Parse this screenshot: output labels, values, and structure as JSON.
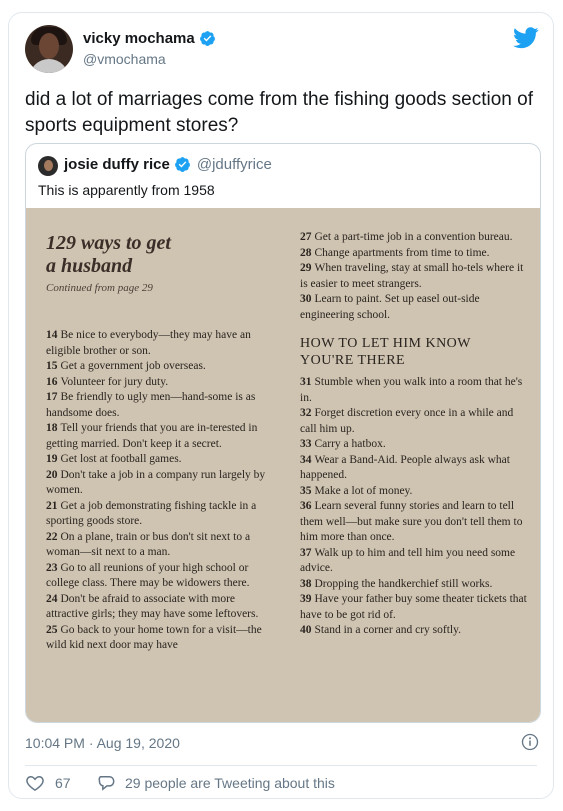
{
  "tweet": {
    "author_name": "vicky mochama",
    "author_handle": "@vmochama",
    "text": "did a lot of marriages come from the fishing goods section of sports equipment stores?",
    "timestamp": "10:04 PM · Aug 19, 2020",
    "likes": "67",
    "tweeting_about": "29 people are Tweeting about this"
  },
  "quote": {
    "author_name": "josie duffy rice",
    "author_handle": "@jduffyrice",
    "text": "This is apparently from 1958"
  },
  "article": {
    "title_line1": "129 ways to get",
    "title_line2": "a husband",
    "continued": "Continued from page 29",
    "left_entries": [
      {
        "num": "14",
        "text": "Be nice to everybody—they may have an eligible brother or son."
      },
      {
        "num": "15",
        "text": "Get a government job overseas."
      },
      {
        "num": "16",
        "text": "Volunteer for jury duty."
      },
      {
        "num": "17",
        "text": "Be friendly to ugly men—hand-some is as handsome does."
      },
      {
        "num": "18",
        "text": "Tell your friends that you are in-terested in getting married. Don't keep it a secret."
      },
      {
        "num": "19",
        "text": "Get lost at football games."
      },
      {
        "num": "20",
        "text": "Don't take a job in a company run largely by women."
      },
      {
        "num": "21",
        "text": "Get a job demonstrating fishing tackle in a sporting goods store."
      },
      {
        "num": "22",
        "text": "On a plane, train or bus don't sit next to a woman—sit next to a man."
      },
      {
        "num": "23",
        "text": "Go to all reunions of your high school or college class. There may be widowers there."
      },
      {
        "num": "24",
        "text": "Don't be afraid to associate with more attractive girls; they may have some leftovers."
      },
      {
        "num": "25",
        "text": "Go back to your home town for a visit—the wild kid next door may have"
      }
    ],
    "right_entries_top": [
      {
        "num": "27",
        "text": "Get a part-time job in a convention bureau."
      },
      {
        "num": "28",
        "text": "Change apartments from time to time."
      },
      {
        "num": "29",
        "text": "When traveling, stay at small ho-tels where it is easier to meet strangers."
      },
      {
        "num": "30",
        "text": "Learn to paint. Set up easel out-side engineering school."
      }
    ],
    "section_heading_line1": "HOW TO LET HIM KNOW",
    "section_heading_line2": "YOU'RE THERE",
    "right_entries_bottom": [
      {
        "num": "31",
        "text": "Stumble when you walk into a room that he's in."
      },
      {
        "num": "32",
        "text": "Forget discretion every once in a while and call him up."
      },
      {
        "num": "33",
        "text": "Carry a hatbox."
      },
      {
        "num": "34",
        "text": "Wear a Band-Aid. People always ask what happened."
      },
      {
        "num": "35",
        "text": "Make a lot of money."
      },
      {
        "num": "36",
        "text": "Learn several funny stories and learn to tell them well—but make sure you don't tell them to him more than once."
      },
      {
        "num": "37",
        "text": "Walk up to him and tell him you need some advice."
      },
      {
        "num": "38",
        "text": "Dropping the handkerchief still works."
      },
      {
        "num": "39",
        "text": "Have your father buy some theater tickets that have to be got rid of."
      },
      {
        "num": "40",
        "text": "Stand in a corner and cry softly."
      }
    ]
  },
  "colors": {
    "twitter_blue": "#1da1f2",
    "text_primary": "#14171a",
    "text_secondary": "#657786",
    "paper": "#cfc4b1"
  },
  "icons": [
    "verified-badge-icon",
    "twitter-bird-icon",
    "info-icon",
    "heart-icon",
    "speech-bubble-icon"
  ]
}
